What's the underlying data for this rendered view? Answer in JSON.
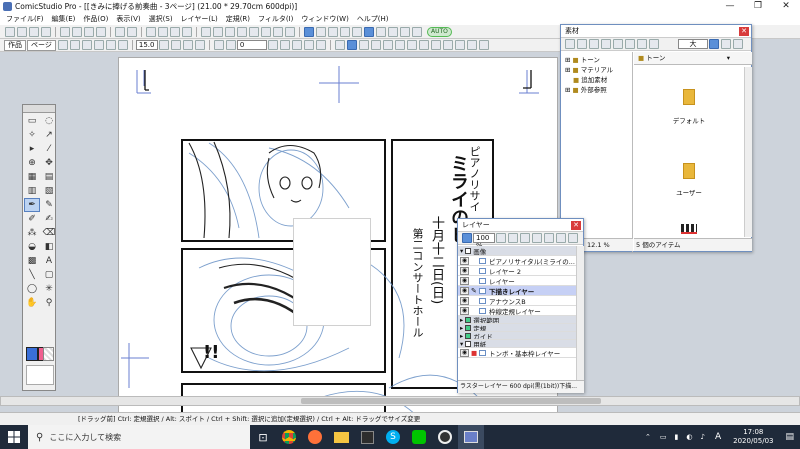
{
  "window": {
    "title": "ComicStudio Pro - [[きみに捧げる前奏曲 - 3ページ] (21.00 * 29.70cm 600dpi)]",
    "minimize": "—",
    "maximize": "❐",
    "close": "✕"
  },
  "menu": [
    "ファイル(F)",
    "編集(E)",
    "作品(O)",
    "表示(V)",
    "選択(S)",
    "レイヤー(L)",
    "定規(R)",
    "フィルタ(I)",
    "ウィンドウ(W)",
    "ヘルプ(H)"
  ],
  "toolbar": {
    "tab_work": "作品",
    "tab_page": "ページ",
    "brush_size": "15.0",
    "angle": "0",
    "badge": "AUTO"
  },
  "manga": {
    "v_text_1": "ピアノリサイ",
    "v_text_2": "ミライのヒ",
    "v_text_3": "十月十二日(日)",
    "v_text_4": "第二コンサートホール",
    "sfx": "!!"
  },
  "material": {
    "title": "素材",
    "size_select": "大",
    "tree": [
      "トーン",
      "マテリアル",
      "追加素材",
      "外部参照"
    ],
    "current_folder": "トーン",
    "folders": [
      {
        "label": "デフォルト"
      },
      {
        "label": "ユーザー"
      }
    ],
    "zoom": "12.1 %",
    "count": "5 個のアイテム"
  },
  "layers": {
    "title": "レイヤー",
    "zoom": "100 %",
    "rows": [
      {
        "label": "画像",
        "kind": "group"
      },
      {
        "label": "ピアノリサイタル(ミライの...",
        "kind": "layer"
      },
      {
        "label": "レイヤー 2",
        "kind": "layer"
      },
      {
        "label": "レイヤー",
        "kind": "layer"
      },
      {
        "label": "下描きレイヤー",
        "kind": "selected"
      },
      {
        "label": "アナウンスB",
        "kind": "layer"
      },
      {
        "label": "枠線定規レイヤー",
        "kind": "layer"
      },
      {
        "label": "選択範囲",
        "kind": "group"
      },
      {
        "label": "定規",
        "kind": "group"
      },
      {
        "label": "ガイド",
        "kind": "group"
      },
      {
        "label": "用紙",
        "kind": "group"
      },
      {
        "label": "トンボ・基本枠レイヤー",
        "kind": "layer"
      }
    ],
    "status": "ラスターレイヤー 600 dpi(黒(1bit))下描..."
  },
  "status_bar": "[ドラッグ前] Ctrl: 定規選択 / Alt: スポイト / Ctrl + Shift: 選択に追加(定規選択) / Ctrl + Alt: ドラッグでサイズ変更",
  "taskbar": {
    "search_placeholder": "ここに入力して検索",
    "ime": "A",
    "time": "17:08",
    "date": "2020/05/03"
  }
}
